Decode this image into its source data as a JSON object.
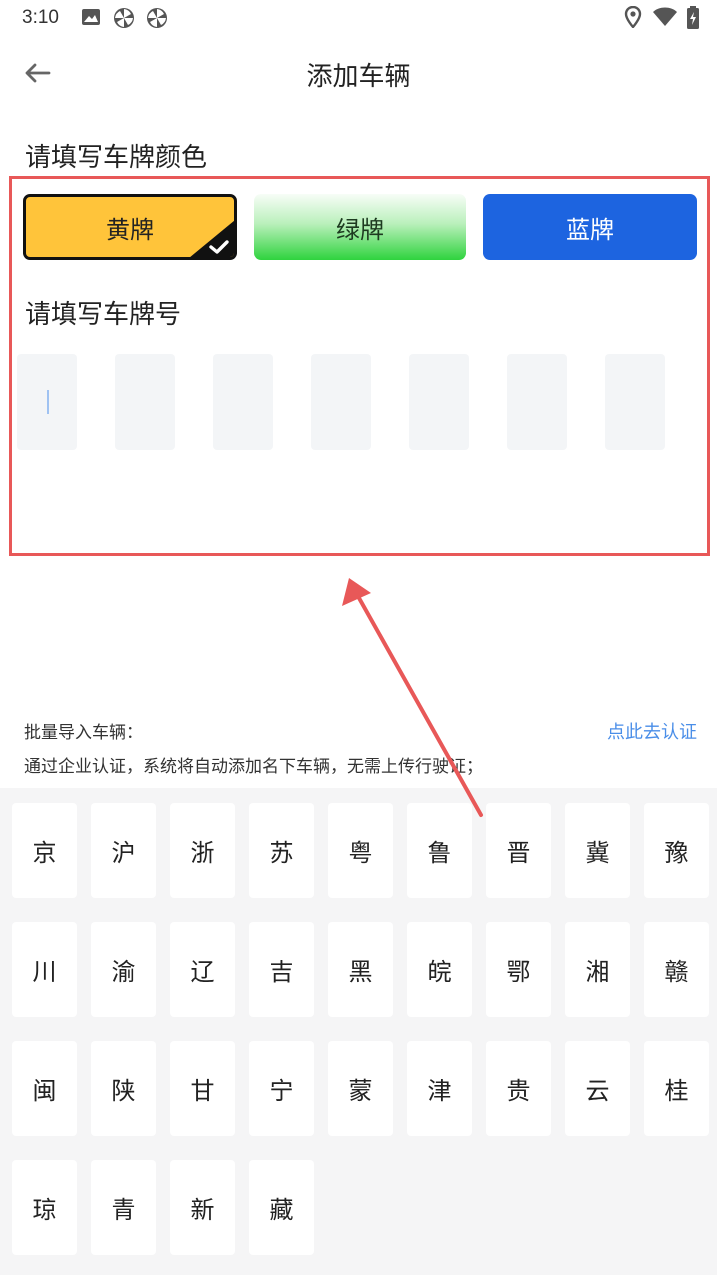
{
  "status_bar": {
    "time": "3:10",
    "left_icons": [
      "image-icon",
      "pinwheel-icon",
      "pinwheel-icon"
    ],
    "right_icons": [
      "location-icon",
      "wifi-icon",
      "battery-icon"
    ]
  },
  "header": {
    "back_icon": "arrow-left-icon",
    "title": "添加车辆"
  },
  "plate_color": {
    "title": "请填写车牌颜色",
    "options": [
      {
        "label": "黄牌",
        "selected": true,
        "color": "#ffc43a"
      },
      {
        "label": "绿牌",
        "selected": false,
        "color": "#2fd33e"
      },
      {
        "label": "蓝牌",
        "selected": false,
        "color": "#1d64e0"
      }
    ]
  },
  "plate_number": {
    "title": "请填写车牌号",
    "fields": [
      "",
      "",
      "",
      "",
      "",
      "",
      ""
    ]
  },
  "batch_import": {
    "label": "批量导入车辆：",
    "link": "点此去认证",
    "description": "通过企业认证，系统将自动添加名下车辆，无需上传行驶证；"
  },
  "keyboard": {
    "rows": [
      [
        "京",
        "沪",
        "浙",
        "苏",
        "粤",
        "鲁",
        "晋",
        "冀",
        "豫"
      ],
      [
        "川",
        "渝",
        "辽",
        "吉",
        "黑",
        "皖",
        "鄂",
        "湘",
        "赣"
      ],
      [
        "闽",
        "陕",
        "甘",
        "宁",
        "蒙",
        "津",
        "贵",
        "云",
        "桂"
      ],
      [
        "琼",
        "青",
        "新",
        "藏"
      ]
    ]
  },
  "annotation": {
    "box_color": "#e85858",
    "arrow_color": "#e85858"
  }
}
